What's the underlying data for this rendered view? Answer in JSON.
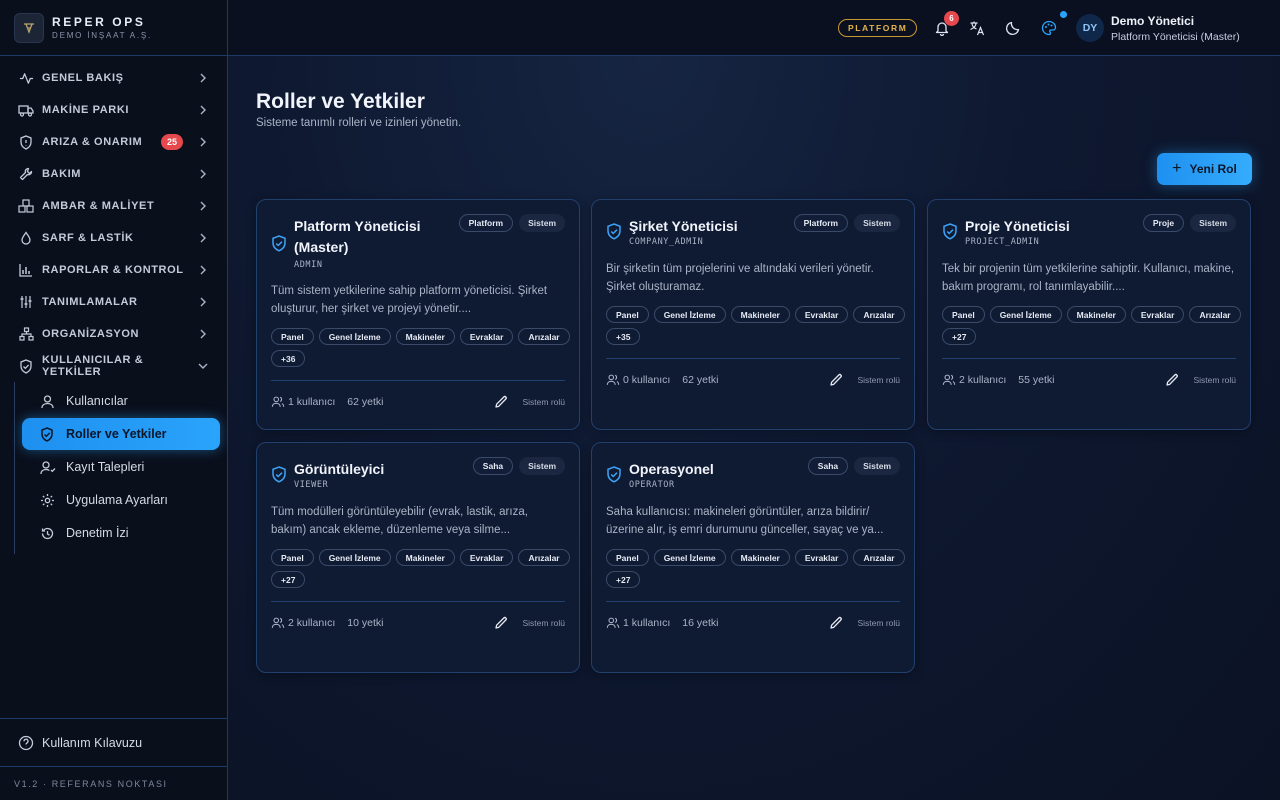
{
  "brand": {
    "name": "REPER OPS",
    "company": "DEMO İNŞAAT A.Ş."
  },
  "sidebar": {
    "items": [
      {
        "label": "GENEL BAKIŞ",
        "icon": "activity-icon"
      },
      {
        "label": "MAKİNE PARKI",
        "icon": "truck-icon"
      },
      {
        "label": "ARIZA & ONARIM",
        "icon": "shield-alert-icon",
        "badge": "25"
      },
      {
        "label": "BAKIM",
        "icon": "wrench-icon"
      },
      {
        "label": "AMBAR & MALİYET",
        "icon": "boxes-icon"
      },
      {
        "label": "SARF & LASTİK",
        "icon": "droplet-icon"
      },
      {
        "label": "RAPORLAR & KONTROL",
        "icon": "bar-chart-icon"
      },
      {
        "label": "TANIMLAMALAR",
        "icon": "sliders-icon"
      },
      {
        "label": "ORGANİZASYON",
        "icon": "network-icon"
      },
      {
        "label": "KULLANICILAR & YETKİLER",
        "icon": "shield-check-icon"
      }
    ],
    "sub_items": [
      {
        "label": "Kullanıcılar",
        "icon": "users-icon"
      },
      {
        "label": "Roller ve Yetkiler",
        "icon": "shield-icon",
        "active": true
      },
      {
        "label": "Kayıt Talepleri",
        "icon": "user-plus-icon"
      },
      {
        "label": "Uygulama Ayarları",
        "icon": "gear-icon"
      },
      {
        "label": "Denetim İzi",
        "icon": "history-icon"
      }
    ],
    "help_label": "Kullanım Kılavuzu",
    "version": "V1.2 · REFERANS NOKTASI"
  },
  "topbar": {
    "platform_label": "PLATFORM",
    "notification_count": "6",
    "user_initials": "DY",
    "user_name": "Demo Yönetici",
    "user_role": "Platform Yöneticisi (Master)"
  },
  "page": {
    "title": "Roller ve Yetkiler",
    "subtitle": "Sisteme tanımlı rolleri ve izinleri yönetin.",
    "new_role_label": "Yeni Rol"
  },
  "roles": [
    {
      "title": "Platform Yöneticisi (Master)",
      "code": "ADMIN",
      "tags": [
        "Platform",
        "Sistem"
      ],
      "description": "Tüm sistem yetkilerine sahip platform yöneticisi. Şirket oluşturur, her şirket ve projeyi yönetir....",
      "permissions": [
        "Panel",
        "Genel İzleme",
        "Makineler",
        "Evraklar",
        "Arızalar"
      ],
      "more": "+36",
      "users": "1 kullanıcı",
      "perm_count": "62 yetki",
      "system_label": "Sistem rolü"
    },
    {
      "title": "Şirket Yöneticisi",
      "code": "COMPANY_ADMIN",
      "tags": [
        "Platform",
        "Sistem"
      ],
      "description": "Bir şirketin tüm projelerini ve altındaki verileri yönetir. Şirket oluşturamaz.",
      "permissions": [
        "Panel",
        "Genel İzleme",
        "Makineler",
        "Evraklar",
        "Arızalar"
      ],
      "more": "+35",
      "users": "0 kullanıcı",
      "perm_count": "62 yetki",
      "system_label": "Sistem rolü"
    },
    {
      "title": "Proje Yöneticisi",
      "code": "PROJECT_ADMIN",
      "tags": [
        "Proje",
        "Sistem"
      ],
      "description": "Tek bir projenin tüm yetkilerine sahiptir. Kullanıcı, makine, bakım programı, rol tanımlayabilir....",
      "permissions": [
        "Panel",
        "Genel İzleme",
        "Makineler",
        "Evraklar",
        "Arızalar"
      ],
      "more": "+27",
      "users": "2 kullanıcı",
      "perm_count": "55 yetki",
      "system_label": "Sistem rolü"
    },
    {
      "title": "Görüntüleyici",
      "code": "VIEWER",
      "tags": [
        "Saha",
        "Sistem"
      ],
      "description": "Tüm modülleri görüntüleyebilir (evrak, lastik, arıza, bakım) ancak ekleme, düzenleme veya silme...",
      "permissions": [
        "Panel",
        "Genel İzleme",
        "Makineler",
        "Evraklar",
        "Arızalar"
      ],
      "more": "+27",
      "users": "2 kullanıcı",
      "perm_count": "10 yetki",
      "system_label": "Sistem rolü"
    },
    {
      "title": "Operasyonel",
      "code": "OPERATOR",
      "tags": [
        "Saha",
        "Sistem"
      ],
      "description": "Saha kullanıcısı: makineleri görüntüler, arıza bildirir/üzerine alır, iş emri durumunu günceller, sayaç ve ya...",
      "permissions": [
        "Panel",
        "Genel İzleme",
        "Makineler",
        "Evraklar",
        "Arızalar"
      ],
      "more": "+27",
      "users": "1 kullanıcı",
      "perm_count": "16 yetki",
      "system_label": "Sistem rolü"
    }
  ],
  "colors": {
    "accent": "#2aa4fb",
    "danger": "#e5484d",
    "gold": "#e2b44a",
    "card_border": "#22406e"
  }
}
